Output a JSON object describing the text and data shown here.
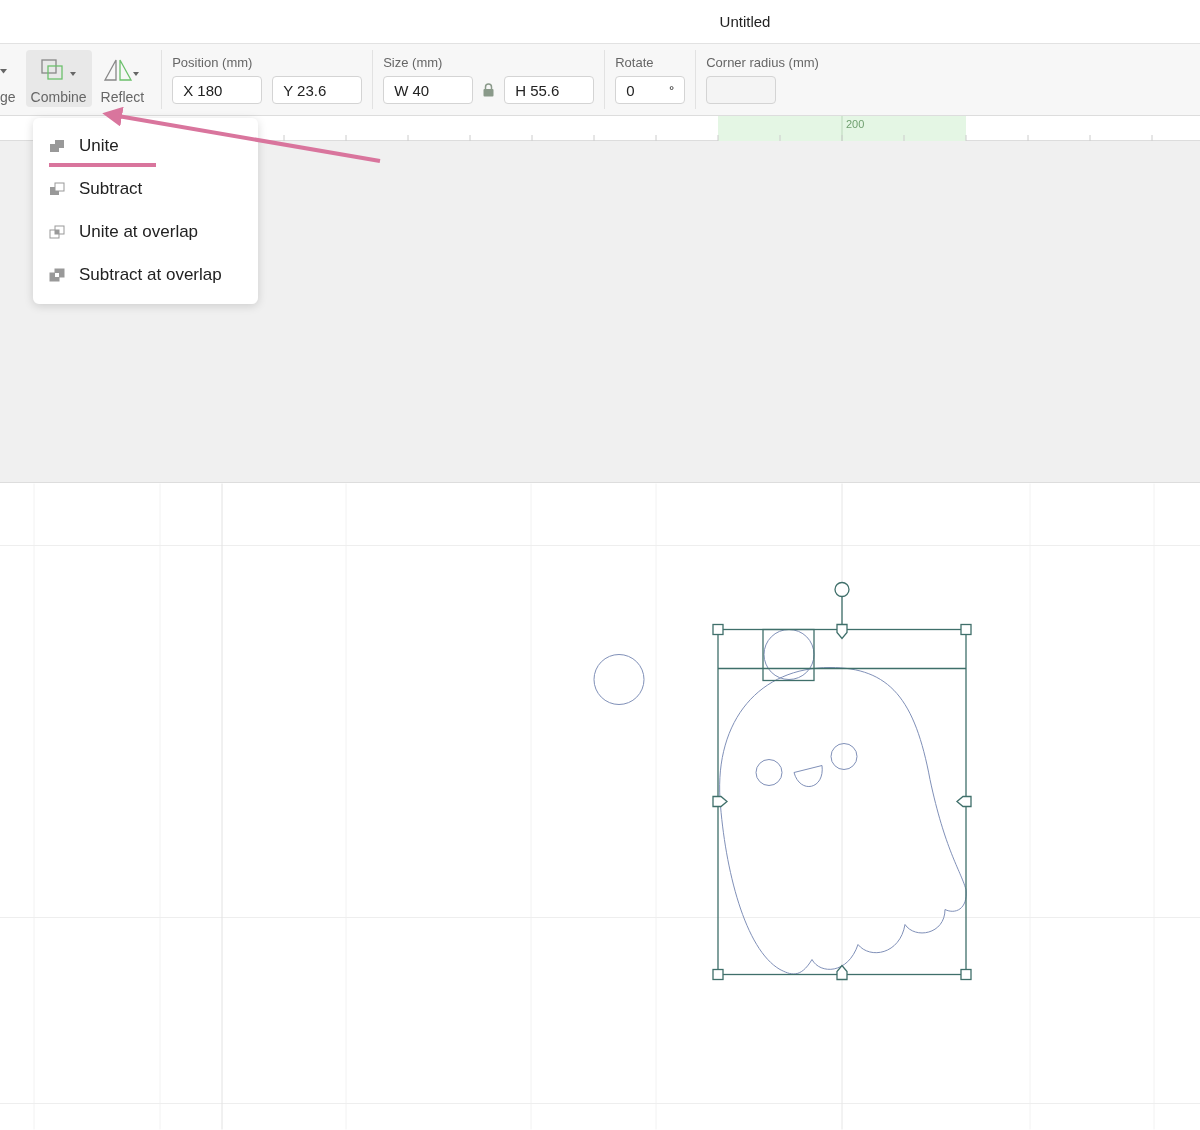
{
  "window": {
    "title": "Untitled"
  },
  "toolbar": {
    "tools": [
      {
        "label": "ge",
        "kind": "partial",
        "selected": false
      },
      {
        "label": "Combine",
        "kind": "combine",
        "selected": true
      },
      {
        "label": "Reflect",
        "kind": "reflect",
        "selected": false
      }
    ],
    "fields": [
      {
        "label": "Position (mm)",
        "inputs": [
          {
            "value": "X 180"
          },
          {
            "value": "Y 23.6"
          }
        ]
      },
      {
        "label": "Size (mm)",
        "locked": true,
        "inputs": [
          {
            "value": "W 40"
          },
          {
            "value": "H 55.6"
          }
        ]
      },
      {
        "label": "Rotate",
        "inputs": [
          {
            "value": "0",
            "unit": "°"
          }
        ]
      },
      {
        "label": "Corner radius (mm)",
        "inputs": [
          {
            "disabled": true
          }
        ]
      }
    ]
  },
  "ruler": {
    "label": "200"
  },
  "combine_menu": {
    "items": [
      {
        "label": "Unite",
        "kind": "unite",
        "underlined": true
      },
      {
        "label": "Subtract",
        "kind": "subtract",
        "underlined": false
      },
      {
        "label": "Unite at overlap",
        "kind": "unite-overlap",
        "underlined": false
      },
      {
        "label": "Subtract at overlap",
        "kind": "subtract-overlap",
        "underlined": false
      }
    ]
  }
}
